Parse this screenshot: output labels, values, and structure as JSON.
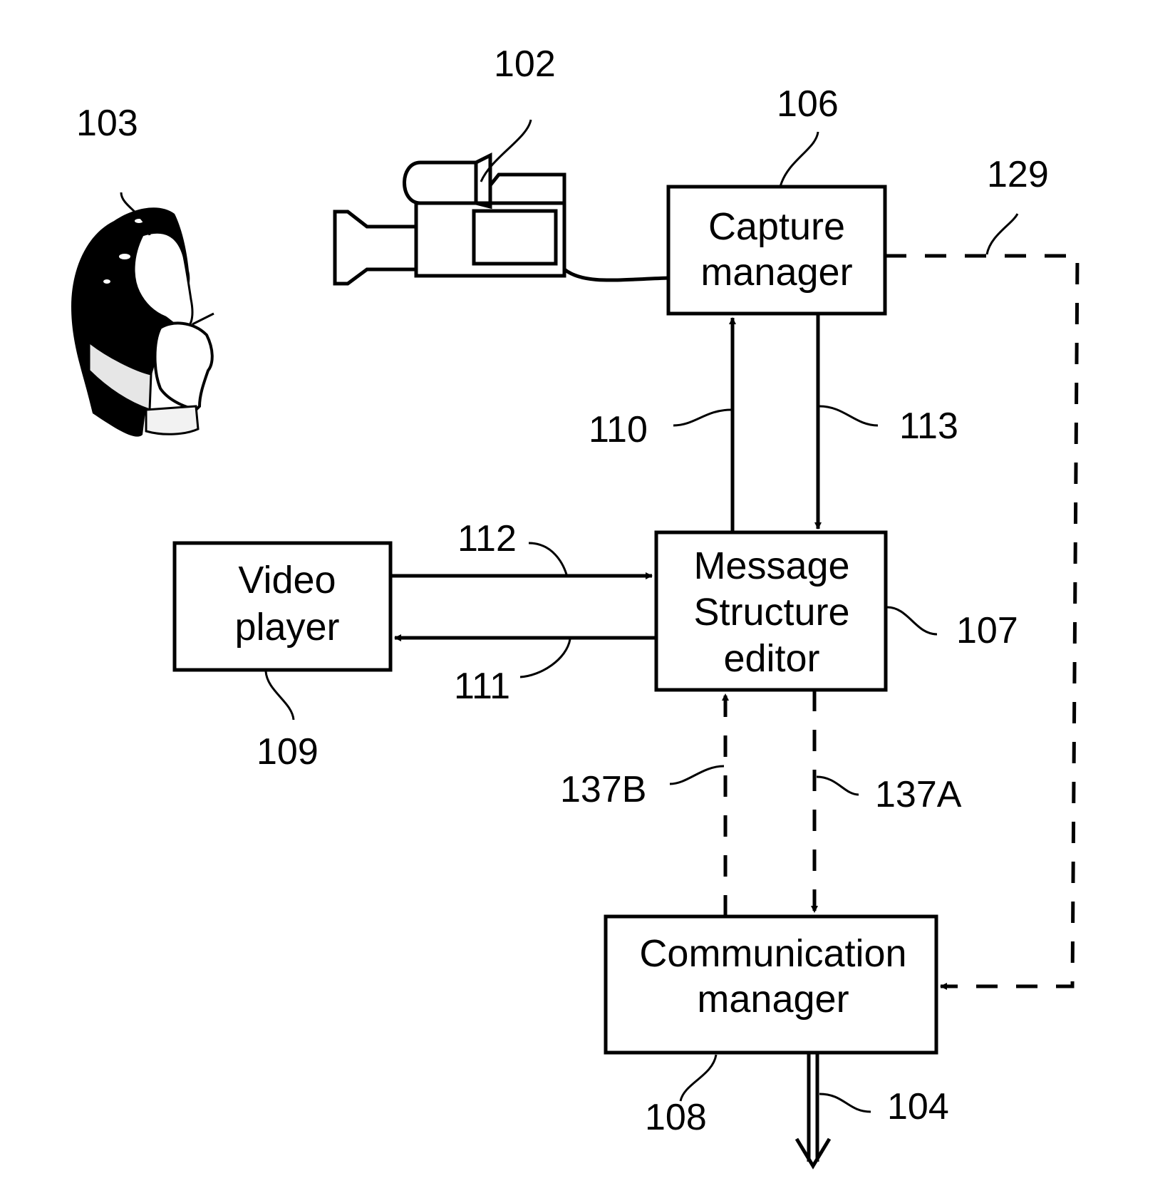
{
  "figure": {
    "blocks": {
      "capture_manager": {
        "ref": "106",
        "lines": [
          "Capture",
          "manager"
        ]
      },
      "video_player": {
        "ref": "109",
        "lines": [
          "Video",
          "player"
        ]
      },
      "message_structure_editor": {
        "ref": "107",
        "lines": [
          "Message",
          "Structure",
          "editor"
        ]
      },
      "communication_manager": {
        "ref": "108",
        "lines": [
          "Communication",
          "manager"
        ]
      }
    },
    "illustrations": {
      "user": {
        "ref": "103",
        "icon": "person-thinking-icon"
      },
      "camera": {
        "ref": "102",
        "icon": "video-camera-icon"
      }
    },
    "connections": {
      "c110": {
        "ref": "110",
        "from": "Message Structure editor",
        "to": "Capture manager",
        "style": "solid"
      },
      "c113": {
        "ref": "113",
        "from": "Capture manager",
        "to": "Message Structure editor",
        "style": "solid"
      },
      "c112": {
        "ref": "112",
        "from": "Video player",
        "to": "Message Structure editor",
        "style": "solid"
      },
      "c111": {
        "ref": "111",
        "from": "Message Structure editor",
        "to": "Video player",
        "style": "solid"
      },
      "c137A": {
        "ref": "137A",
        "from": "Message Structure editor",
        "to": "Communication manager",
        "style": "dashed"
      },
      "c137B": {
        "ref": "137B",
        "from": "Communication manager",
        "to": "Message Structure editor",
        "style": "dashed"
      },
      "c129": {
        "ref": "129",
        "from": "Capture manager",
        "to": "Communication manager",
        "style": "dashed"
      },
      "c104": {
        "ref": "104",
        "from": "Communication manager",
        "to": "output",
        "style": "double"
      }
    }
  }
}
